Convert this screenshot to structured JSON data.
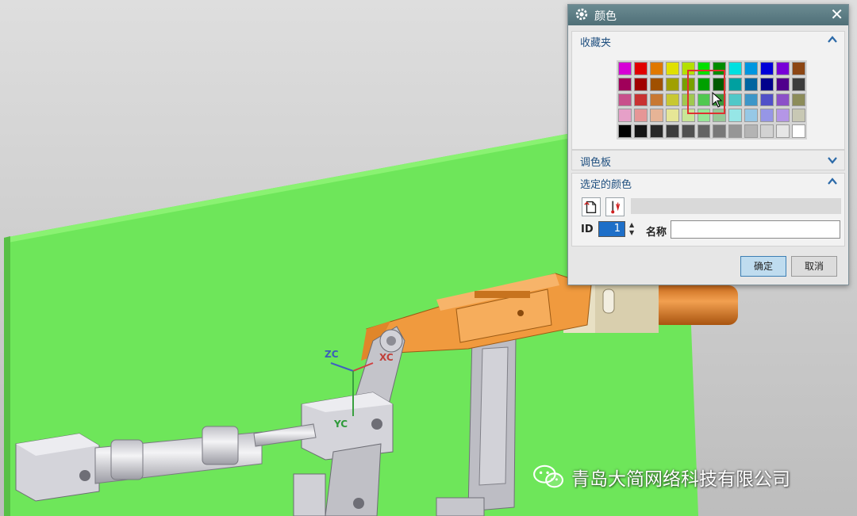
{
  "viewport": {
    "axes": {
      "zc": "ZC",
      "xc": "XC",
      "yc": "YC"
    },
    "colors": {
      "board": "#6ee65a",
      "arm": "#f09a3e",
      "metal": "#d7d7dc",
      "background": "#c8c8c8"
    }
  },
  "dialog": {
    "title": "颜色",
    "icon": "gear-icon",
    "close_icon": "close-icon",
    "favorites": {
      "label": "收藏夹",
      "expanded": true,
      "swatches": [
        "#d600d6",
        "#e00000",
        "#e07800",
        "#e0e000",
        "#b4e000",
        "#00e000",
        "#008c00",
        "#00e0e0",
        "#0096e0",
        "#0000d8",
        "#7800d8",
        "#8c4614",
        "#a0005a",
        "#a00000",
        "#a05000",
        "#a0a000",
        "#78a000",
        "#00a000",
        "#005a00",
        "#00a0a0",
        "#0064a0",
        "#00008c",
        "#50008c",
        "#3c3c3c",
        "#c8508c",
        "#c83232",
        "#c87832",
        "#c8c832",
        "#a0c850",
        "#50c850",
        "#3c963c",
        "#50c8c8",
        "#3c96c8",
        "#5050c8",
        "#8c50c8",
        "#8c8c5a",
        "#e6a0c8",
        "#e69696",
        "#e6b496",
        "#e6e696",
        "#c8e696",
        "#96e696",
        "#96c896",
        "#96e6e6",
        "#96c8e6",
        "#9696e6",
        "#b496e6",
        "#c8c8b4",
        "#000000",
        "#141414",
        "#282828",
        "#3c3c3c",
        "#505050",
        "#646464",
        "#787878",
        "#969696",
        "#b4b4b4",
        "#d2d2d2",
        "#e6e6e6",
        "#ffffff"
      ]
    },
    "palette": {
      "label": "调色板",
      "expanded": false
    },
    "selected": {
      "label": "选定的颜色",
      "id_label": "ID",
      "id_value": "1",
      "name_label": "名称",
      "name_value": ""
    },
    "buttons": {
      "ok": "确定",
      "cancel": "取消"
    }
  },
  "watermark": {
    "text": "青岛大简网络科技有限公司",
    "icon": "wechat-icon"
  }
}
